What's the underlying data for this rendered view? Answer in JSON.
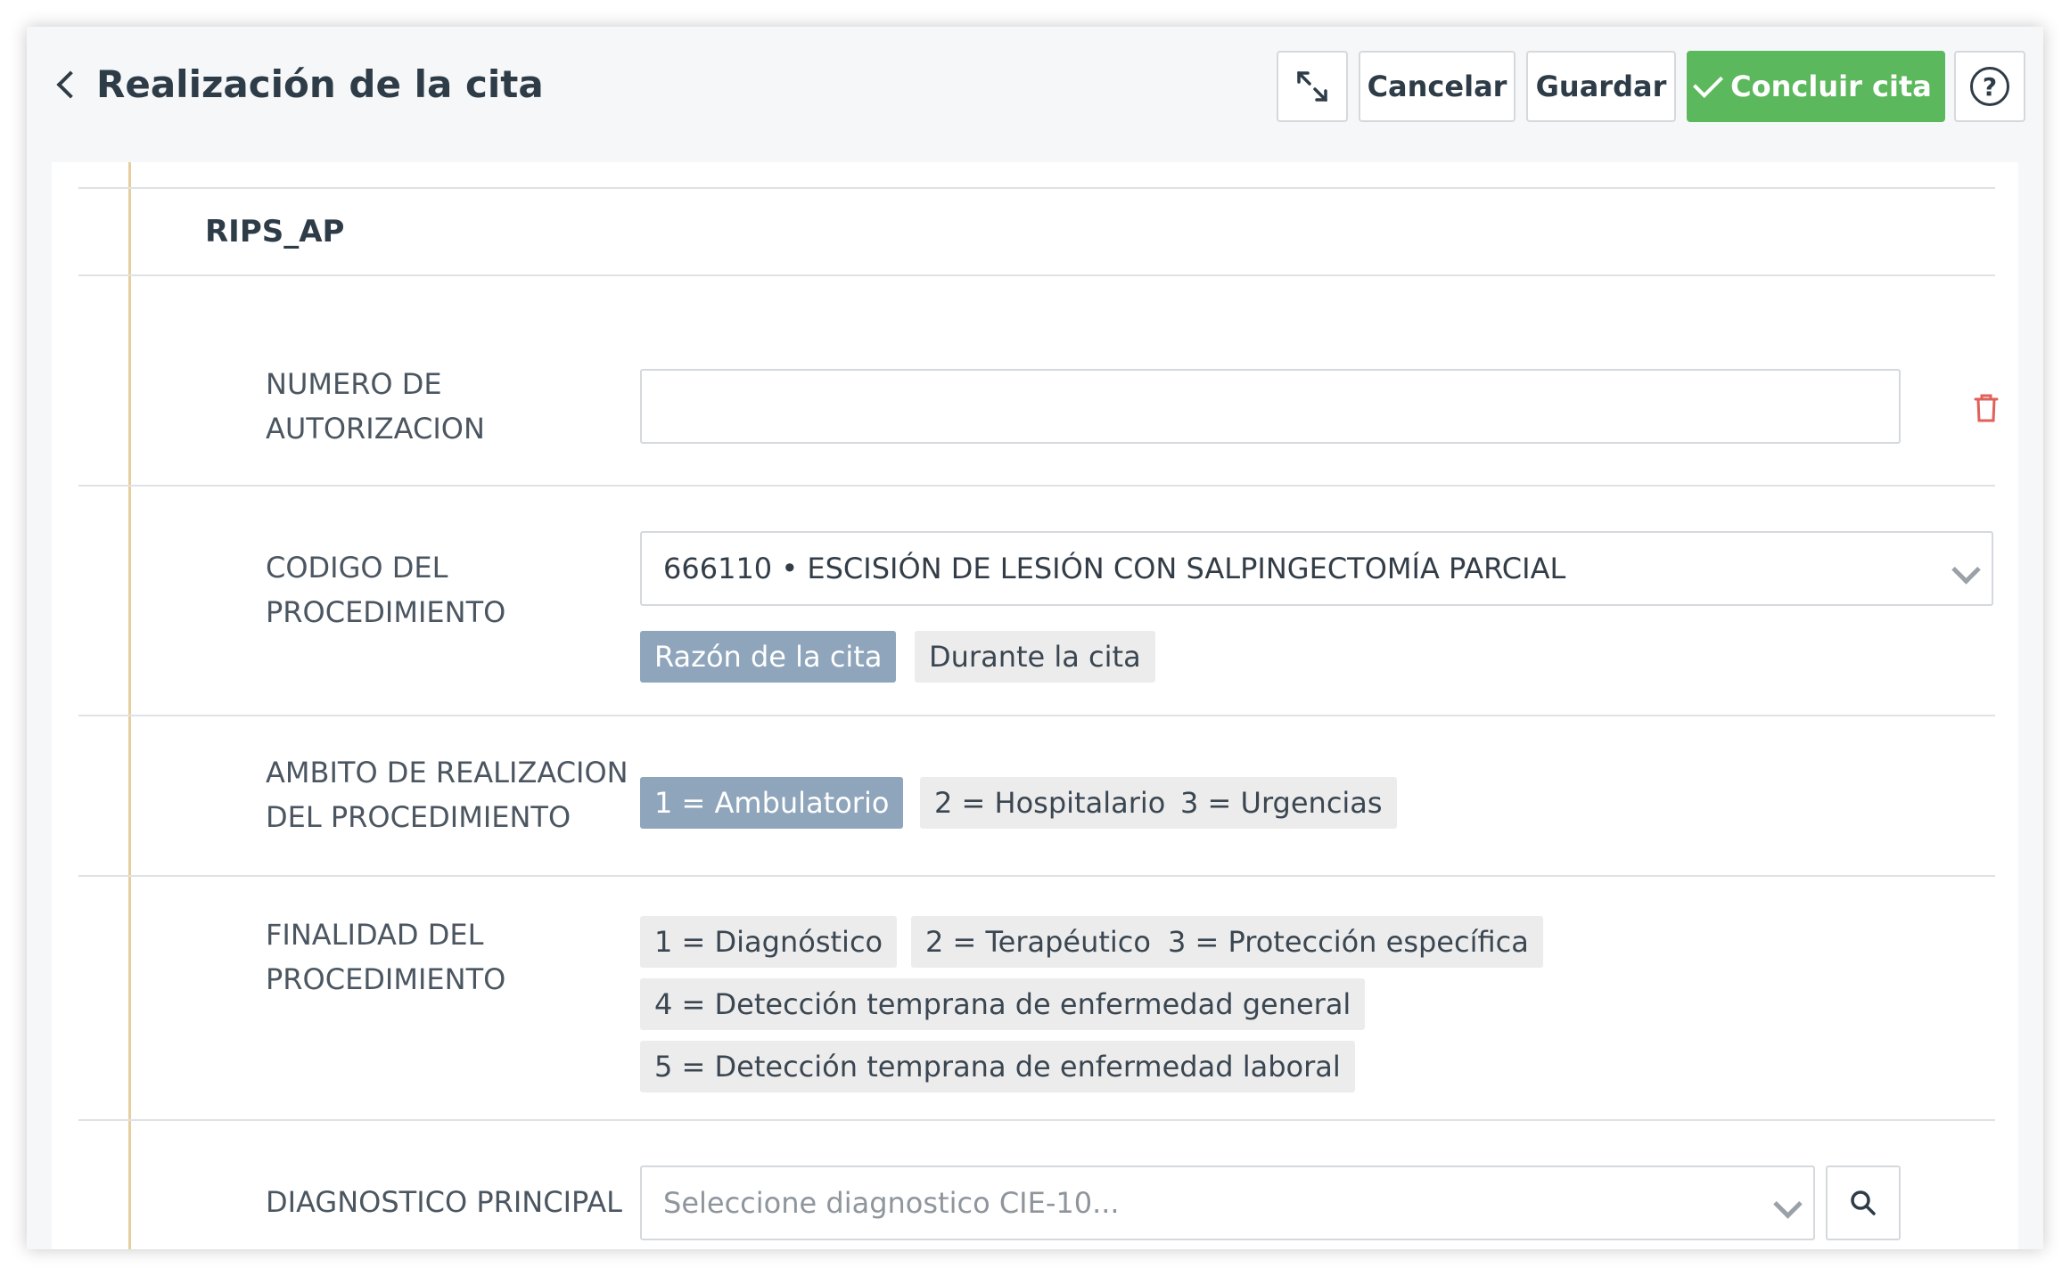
{
  "header": {
    "title": "Realización de la cita",
    "buttons": {
      "cancel": "Cancelar",
      "save": "Guardar",
      "conclude": "Concluir cita",
      "help": "?"
    }
  },
  "section": {
    "title": "RIPS_AP"
  },
  "fields": {
    "authorization": {
      "label_line1": "NUMERO DE",
      "label_line2": "AUTORIZACION",
      "value": ""
    },
    "procedure_code": {
      "label_line1": "CODIGO DEL",
      "label_line2": "PROCEDIMIENTO",
      "value": "666110 • ESCISIÓN DE LESIÓN CON SALPINGECTOMÍA PARCIAL",
      "options": [
        "Razón de la cita",
        "Durante la cita"
      ],
      "selected": "Razón de la cita"
    },
    "scope": {
      "label_line1": "AMBITO DE REALIZACION",
      "label_line2": "DEL PROCEDIMIENTO",
      "options": [
        "1 = Ambulatorio",
        "2 = Hospitalario",
        "3 = Urgencias"
      ],
      "selected": "1 = Ambulatorio"
    },
    "purpose": {
      "label_line1": "FINALIDAD DEL",
      "label_line2": "PROCEDIMIENTO",
      "options": [
        "1 = Diagnóstico",
        "2 = Terapéutico",
        "3 = Protección específica",
        "4 = Detección temprana de enfermedad general",
        "5 = Detección temprana de enfermedad laboral"
      ]
    },
    "diagnosis": {
      "label": "DIAGNOSTICO PRINCIPAL",
      "placeholder": "Seleccione diagnostico CIE-10..."
    }
  },
  "icons": [
    "chevron-left-icon",
    "expand-icon",
    "check-icon",
    "help-icon",
    "trash-icon",
    "chevron-down-icon",
    "search-icon"
  ],
  "colors": {
    "primary_green": "#5cb85c",
    "chip_active": "#8fa5bb",
    "chip_inactive": "#ececec",
    "delete_red": "#e0605a",
    "timeline_line": "#e6cf9f"
  }
}
